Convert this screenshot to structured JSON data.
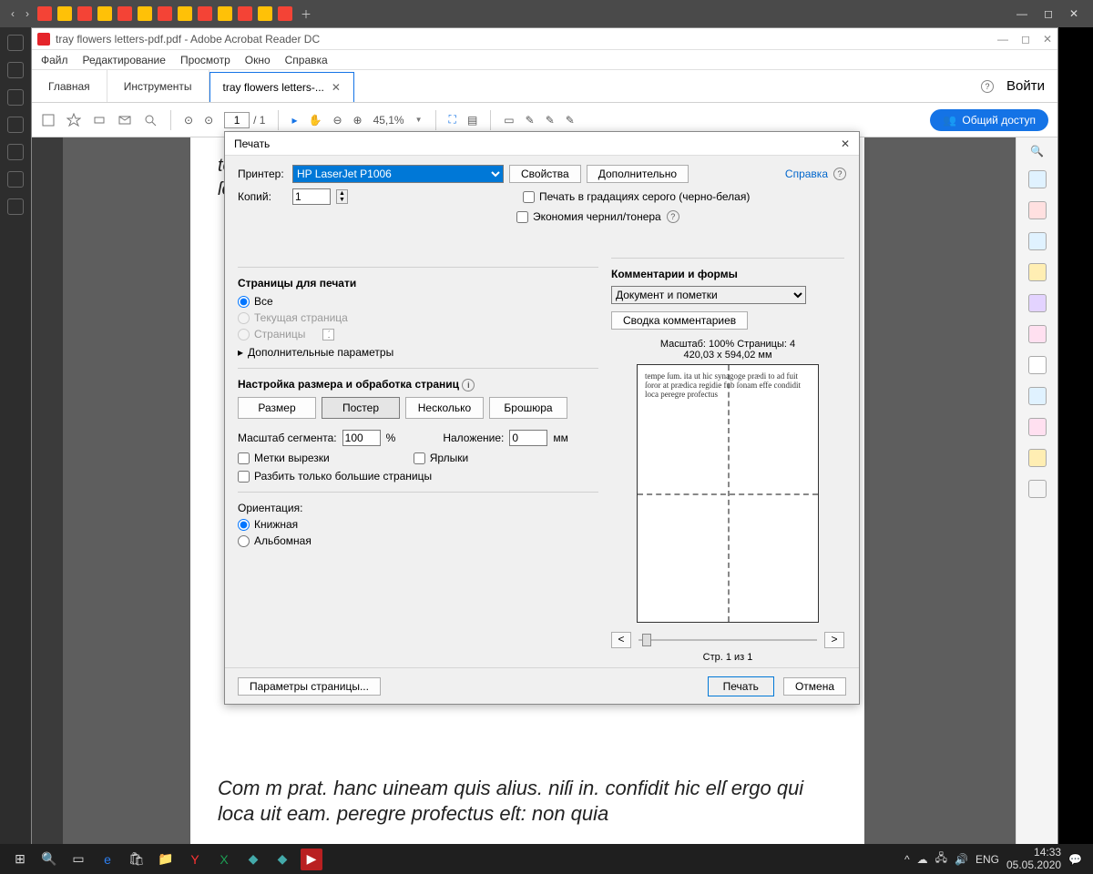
{
  "browser": {
    "win_min": "—",
    "win_max": "◻",
    "win_close": "✕"
  },
  "acrobat": {
    "title": "tray flowers letters-pdf.pdf - Adobe Acrobat Reader DC",
    "menu": [
      "Файл",
      "Редактирование",
      "Просмотр",
      "Окно",
      "Справка"
    ],
    "tab_home": "Главная",
    "tab_tools": "Инструменты",
    "tab_doc": "tray flowers letters-...",
    "help_icon": "?",
    "signin": "Войти",
    "share": "Общий доступ",
    "page_current": "1",
    "page_total": "/  1",
    "zoom": "45,1%"
  },
  "print": {
    "title": "Печать",
    "printer_label": "Принтер:",
    "printer_value": "HP LaserJet P1006",
    "properties": "Свойства",
    "advanced": "Дополнительно",
    "help": "Справка",
    "copies_label": "Копий:",
    "copies_value": "1",
    "grayscale": "Печать в градациях серого (черно-белая)",
    "save_ink": "Экономия чернил/тонера",
    "pages_title": "Страницы для печати",
    "all": "Все",
    "current": "Текущая страница",
    "range_label": "Страницы",
    "range_value": "1",
    "more_opts": "Дополнительные параметры",
    "size_title": "Настройка размера и обработка страниц",
    "size_btn": "Размер",
    "poster_btn": "Постер",
    "multi_btn": "Несколько",
    "booklet_btn": "Брошюра",
    "tile_scale_label": "Масштаб сегмента:",
    "tile_scale_value": "100",
    "percent": "%",
    "overlap_label": "Наложение:",
    "overlap_value": "0",
    "mm": "мм",
    "cut_marks": "Метки вырезки",
    "labels": "Ярлыки",
    "only_large": "Разбить только большие страницы",
    "orient_title": "Ориентация:",
    "portrait": "Книжная",
    "landscape": "Альбомная",
    "comments_title": "Комментарии и формы",
    "comments_value": "Документ и пометки",
    "summarize": "Сводка комментариев",
    "scale_pages": "Масштаб: 100% Страницы: 4",
    "dims": "420,03 x 594,02 мм",
    "page_of": "Стр. 1 из 1",
    "prev": "<",
    "next": ">",
    "page_setup": "Параметры страницы...",
    "print_btn": "Печать",
    "cancel": "Отмена"
  },
  "taskbar": {
    "lang": "ENG",
    "time": "14:33",
    "date": "05.05.2020"
  },
  "doc_text_top": "tempe ſum. ita ut hic synagoge. prædi to ad fuit ſoror at prædica. regidie fub ſonam",
  "doc_text_bot": "Com m prat. hanc uineam quis alius. niſi in. confidit hic elſ ergo qui loca uit eam. peregre profectus eſt: non quia"
}
